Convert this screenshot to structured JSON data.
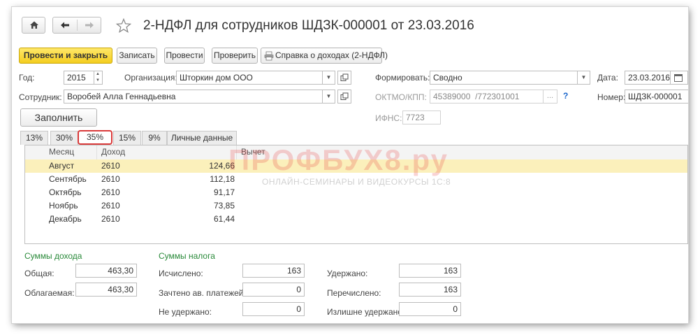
{
  "window": {
    "title": "2-НДФЛ для сотрудников ШДЗК-000001 от 23.03.2016",
    "home_icon": "home-icon",
    "back_icon": "arrow-left-icon",
    "forward_icon": "arrow-right-icon",
    "star_icon": "star-icon"
  },
  "toolbar": {
    "post_close": "Провести и закрыть",
    "save": "Записать",
    "post": "Провести",
    "check": "Проверить",
    "income_cert": "Справка о доходах (2-НДФЛ)",
    "printer_icon": "printer-icon"
  },
  "form": {
    "year_label": "Год:",
    "year_value": "2015",
    "org_label": "Организация:",
    "org_value": "Шторкин дом ООО",
    "employee_label": "Сотрудник:",
    "employee_value": "Воробей Алла Геннадьевна",
    "form_label": "Формировать:",
    "form_value": "Сводно",
    "date_label": "Дата:",
    "date_value": "23.03.2016",
    "oktmo_label": "ОКТМО/КПП:",
    "oktmo_value": "45389000",
    "kpp_value": "/772301001",
    "oktmo_more": "...",
    "help": "?",
    "number_label": "Номер:",
    "number_value": "ШДЗК-000001",
    "ifns_label": "ИФНС:",
    "ifns_value": "7723",
    "fill_button": "Заполнить"
  },
  "tabs": [
    {
      "label": "13%",
      "active": false
    },
    {
      "label": "30%",
      "active": false
    },
    {
      "label": "35%",
      "active": true
    },
    {
      "label": "15%",
      "active": false
    },
    {
      "label": "9%",
      "active": false
    },
    {
      "label": "Личные данные",
      "active": false
    }
  ],
  "table": {
    "headers": [
      "Месяц",
      "Доход",
      "Вычет"
    ],
    "rows": [
      {
        "month": "Август",
        "code": "2610",
        "amount": "124,66",
        "selected": true
      },
      {
        "month": "Сентябрь",
        "code": "2610",
        "amount": "112,18",
        "selected": false
      },
      {
        "month": "Октябрь",
        "code": "2610",
        "amount": "91,17",
        "selected": false
      },
      {
        "month": "Ноябрь",
        "code": "2610",
        "amount": "73,85",
        "selected": false
      },
      {
        "month": "Декабрь",
        "code": "2610",
        "amount": "61,44",
        "selected": false
      }
    ]
  },
  "income": {
    "title": "Суммы дохода",
    "total_label": "Общая:",
    "total_value": "463,30",
    "taxable_label": "Облагаемая:",
    "taxable_value": "463,30"
  },
  "tax": {
    "title": "Суммы налога",
    "calculated_label": "Исчислено:",
    "calculated_value": "163",
    "advance_label": "Зачтено ав. платежей:",
    "advance_value": "0",
    "not_withheld_label": "Не удержано:",
    "not_withheld_value": "0",
    "withheld_label": "Удержано:",
    "withheld_value": "163",
    "transferred_label": "Перечислено:",
    "transferred_value": "163",
    "excess_label": "Излишне удержано:",
    "excess_value": "0"
  },
  "watermark": {
    "brand": "ПРОФБУХ8.ру",
    "tagline": "ОНЛАЙН-СЕМИНАРЫ И ВИДЕОКУРСЫ 1С:8"
  },
  "colors": {
    "primary_button": "#f4cd1f",
    "selected_row": "#fbf0bb",
    "section_title": "#2a8a3a",
    "tab_highlight": "#d93a3a",
    "link": "#1a66cc"
  }
}
